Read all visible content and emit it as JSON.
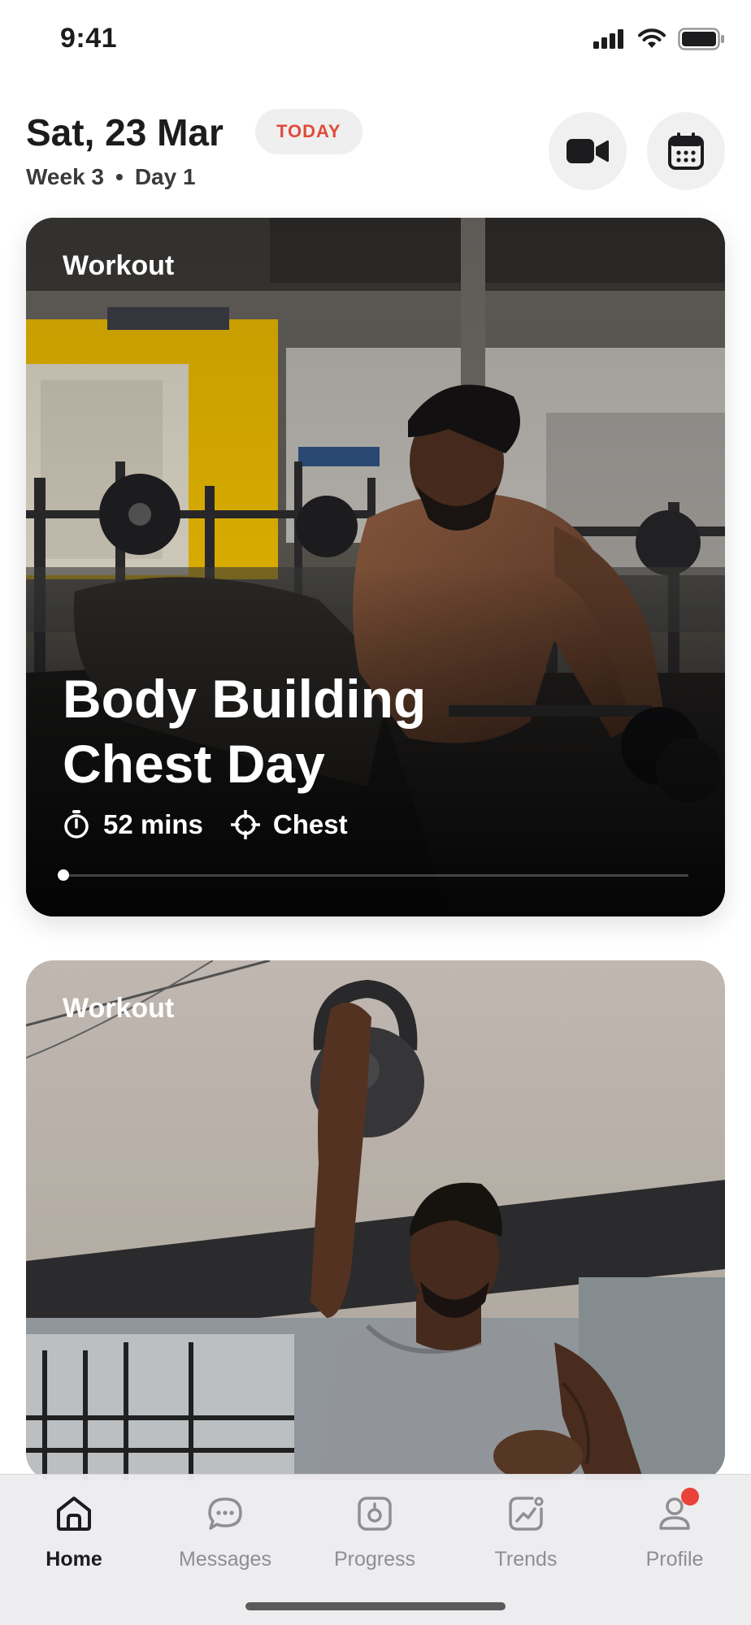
{
  "status_bar": {
    "time": "9:41"
  },
  "header": {
    "date": "Sat, 23 Mar",
    "today_badge": "TODAY",
    "week": "Week 3",
    "separator": "•",
    "day": "Day 1",
    "video_button_icon": "video-camera-icon",
    "calendar_button_icon": "calendar-icon"
  },
  "cards": [
    {
      "label": "Workout",
      "title_line1": "Body Building",
      "title_line2": "Chest Day",
      "duration": "52 mins",
      "target": "Chest",
      "progress": 0
    },
    {
      "label": "Workout"
    }
  ],
  "tab_bar": {
    "items": [
      {
        "label": "Home",
        "icon": "home-icon",
        "active": true
      },
      {
        "label": "Messages",
        "icon": "chat-bubble-icon",
        "active": false
      },
      {
        "label": "Progress",
        "icon": "scale-icon",
        "active": false
      },
      {
        "label": "Trends",
        "icon": "trend-chart-icon",
        "active": false
      },
      {
        "label": "Profile",
        "icon": "user-icon",
        "active": false,
        "notification": true
      }
    ]
  },
  "colors": {
    "accent_red": "#e24a3b",
    "text_primary": "#1c1c1e",
    "text_inactive": "#8e8e93"
  }
}
